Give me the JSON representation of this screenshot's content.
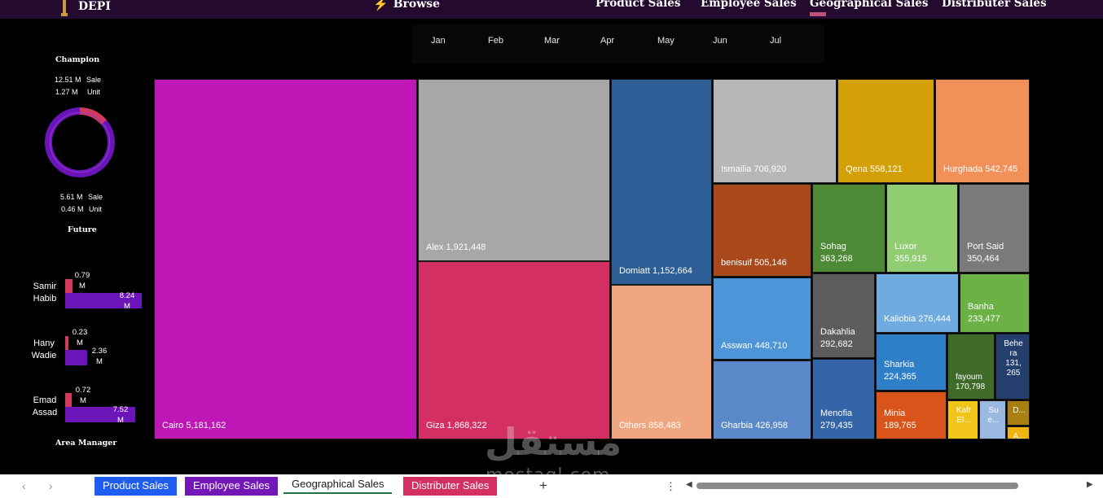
{
  "nav": {
    "logo": "DEPI",
    "browse": "Browse",
    "links": [
      "Product Sales",
      "Employee Sales",
      "Geographical Sales",
      "Distributer Sales"
    ]
  },
  "months": [
    "Jan",
    "Feb",
    "Mar",
    "Apr",
    "May",
    "Jun",
    "Jul"
  ],
  "left_panel": {
    "champion_title": "Champion",
    "champion_sale_value": "12.51 M",
    "champion_sale_label": "Sale",
    "champion_unit_value": "1.27 M",
    "champion_unit_label": "Unit",
    "future_sale_value": "5.61 M",
    "future_sale_label": "Sale",
    "future_unit_value": "0.46 M",
    "future_unit_label": "Unit",
    "future_title": "Future",
    "area_manager_title": "Area Manager",
    "managers": [
      {
        "name": "Samir Habib",
        "red_value": "0.79\nM",
        "purple_value": "8.24\nM"
      },
      {
        "name": "Hany Wadie",
        "red_value": "0.23\nM",
        "purple_value": "2.36\nM"
      },
      {
        "name": "Emad Assad",
        "red_value": "0.72\nM",
        "purple_value": "7.52\nM"
      }
    ]
  },
  "chart_data": {
    "type": "treemap",
    "items": [
      {
        "name": "Cairo",
        "value": 5181162,
        "label": "Cairo  5,181,162",
        "color": "#bf17b5"
      },
      {
        "name": "Alex",
        "value": 1921448,
        "label": "Alex  1,921,448",
        "color": "#a7a7a7"
      },
      {
        "name": "Giza",
        "value": 1868322,
        "label": "Giza  1,868,322",
        "color": "#d42f62"
      },
      {
        "name": "Domiatt",
        "value": 1152664,
        "label": "Domiatt  1,152,664",
        "color": "#2d5e96"
      },
      {
        "name": "Others",
        "value": 858483,
        "label": "Others  858,483",
        "color": "#f0a67f"
      },
      {
        "name": "Ismailia",
        "value": 706920,
        "label": "Ismailia  706,920",
        "color": "#b7b7b7"
      },
      {
        "name": "Qena",
        "value": 558121,
        "label": "Qena  558,121",
        "color": "#d4a007"
      },
      {
        "name": "Hurghada",
        "value": 542745,
        "label": "Hurghada  542,745",
        "color": "#f2905a"
      },
      {
        "name": "benisuif",
        "value": 505146,
        "label": "benisuif  505,146",
        "color": "#a8481b"
      },
      {
        "name": "Sohag",
        "value": 363268,
        "label": "Sohag\n363,268",
        "color": "#4e8a35"
      },
      {
        "name": "Luxor",
        "value": 355915,
        "label": "Luxor\n355,915",
        "color": "#90cc70"
      },
      {
        "name": "Port Said",
        "value": 350464,
        "label": "Port Said\n350,464",
        "color": "#7a7a7a"
      },
      {
        "name": "Asswan",
        "value": 448710,
        "label": "Asswan  448,710",
        "color": "#4d95d8"
      },
      {
        "name": "Gharbia",
        "value": 426958,
        "label": "Gharbia  426,958",
        "color": "#5b88c8"
      },
      {
        "name": "Dakahlia",
        "value": 292682,
        "label": "Dakahlia\n292,682",
        "color": "#5c5c5c"
      },
      {
        "name": "Kaliobia",
        "value": 276444,
        "label": "Kaliobia  276,444",
        "color": "#6fabe0"
      },
      {
        "name": "Banha",
        "value": 233477,
        "label": "Banha\n233,477",
        "color": "#6bb146"
      },
      {
        "name": "Menofia",
        "value": 279435,
        "label": "Menofia\n279,435",
        "color": "#3465a8"
      },
      {
        "name": "Sharkia",
        "value": 224365,
        "label": "Sharkia\n224,365",
        "color": "#2f7fc8"
      },
      {
        "name": "fayoum",
        "value": 170798,
        "label": "fayoum\n170,798",
        "color": "#3f6b2a"
      },
      {
        "name": "Behera",
        "value": 131265,
        "label": "Behe\nra\n131,\n265",
        "color": "#243f6e"
      },
      {
        "name": "Minia",
        "value": 189765,
        "label": "Minia\n189,765",
        "color": "#d9541a"
      },
      {
        "name": "Kafr El...",
        "value": null,
        "label": "Kafr\nEl...",
        "color": "#f0c419"
      },
      {
        "name": "Su e...",
        "value": null,
        "label": "Su\ne...",
        "color": "#9ab8e0"
      },
      {
        "name": "D...",
        "value": null,
        "label": "D...",
        "color": "#a87f10"
      },
      {
        "name": "A...",
        "value": null,
        "label": "A...",
        "color": "#f0b410"
      }
    ]
  },
  "sheet_tabs": [
    {
      "label": "Product Sales",
      "color": "#1f5cf0"
    },
    {
      "label": "Employee Sales",
      "color": "#7417b8"
    },
    {
      "label": "Geographical Sales",
      "color": "#ffffff"
    },
    {
      "label": "Distributer Sales",
      "color": "#d42f62"
    }
  ],
  "add_sheet": "+",
  "more_menu": "⋮",
  "watermark": {
    "arabic": "مستقل",
    "latin": "mostaql.com"
  }
}
